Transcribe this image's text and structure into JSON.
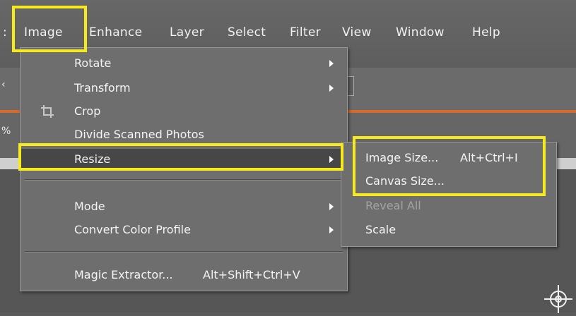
{
  "menubar": {
    "items": [
      {
        "label": "Image"
      },
      {
        "label": "Enhance"
      },
      {
        "label": "Layer"
      },
      {
        "label": "Select"
      },
      {
        "label": "Filter"
      },
      {
        "label": "View"
      },
      {
        "label": "Window"
      },
      {
        "label": "Help"
      }
    ]
  },
  "background": {
    "fragments": [
      "‹",
      "‹",
      "%"
    ]
  },
  "image_menu": {
    "items": [
      {
        "label": "Rotate",
        "has_submenu": true
      },
      {
        "label": "Transform",
        "has_submenu": true
      },
      {
        "label": "Crop",
        "icon": "crop-icon"
      },
      {
        "label": "Divide Scanned Photos"
      },
      {
        "label": "Resize",
        "has_submenu": true,
        "highlighted": true
      },
      {
        "label": "Mode",
        "has_submenu": true
      },
      {
        "label": "Convert Color Profile",
        "has_submenu": true
      },
      {
        "label": "Magic Extractor...",
        "shortcut": "Alt+Shift+Ctrl+V"
      }
    ]
  },
  "resize_submenu": {
    "items": [
      {
        "label": "Image Size...",
        "shortcut": "Alt+Ctrl+I"
      },
      {
        "label": "Canvas Size..."
      },
      {
        "label": "Reveal All",
        "disabled": true
      },
      {
        "label": "Scale"
      }
    ]
  },
  "highlight_color": "#f6ea1c",
  "icons": [
    "crop-icon",
    "crosshair-icon",
    "chevron-right-icon"
  ]
}
